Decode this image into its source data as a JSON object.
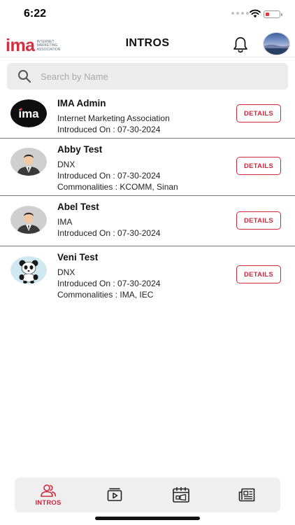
{
  "status_bar": {
    "time": "6:22",
    "battery_level": 0.25
  },
  "header": {
    "logo_mark": "ima",
    "logo_text": "INTERNET MARKETING ASSOCIATION",
    "title": "INTROS",
    "bell_icon": "bell-icon",
    "avatar_icon": "profile-avatar"
  },
  "search": {
    "placeholder": "Search by Name",
    "value": "",
    "icon": "search-icon"
  },
  "intros": [
    {
      "name": "IMA Admin",
      "lines": [
        "Internet Marketing Association",
        "Introduced On : 07-30-2024"
      ],
      "avatar": "ima-logo-avatar",
      "button": "DETAILS"
    },
    {
      "name": "Abby Test",
      "lines": [
        "DNX",
        "Introduced On : 07-30-2024",
        "Commonalities : KCOMM, Sinan"
      ],
      "avatar": "businessman-avatar",
      "button": "DETAILS"
    },
    {
      "name": "Abel Test",
      "lines": [
        "IMA",
        "Introduced On : 07-30-2024"
      ],
      "avatar": "businessman-avatar",
      "button": "DETAILS"
    },
    {
      "name": "Veni Test",
      "lines": [
        "DNX",
        "Introduced On : 07-30-2024",
        "Commonalities : IMA, IEC"
      ],
      "avatar": "panda-avatar",
      "button": "DETAILS"
    }
  ],
  "tabbar": {
    "tabs": [
      {
        "label": "INTROS",
        "icon": "people-icon",
        "active": true
      },
      {
        "label": "",
        "icon": "video-icon",
        "active": false
      },
      {
        "label": "",
        "icon": "calendar-icon",
        "active": false
      },
      {
        "label": "",
        "icon": "newspaper-icon",
        "active": false
      }
    ]
  },
  "colors": {
    "accent": "#d0283a",
    "logo": "#d32f3f",
    "search_bg": "#ececec",
    "tabbar_bg": "#efefef"
  }
}
